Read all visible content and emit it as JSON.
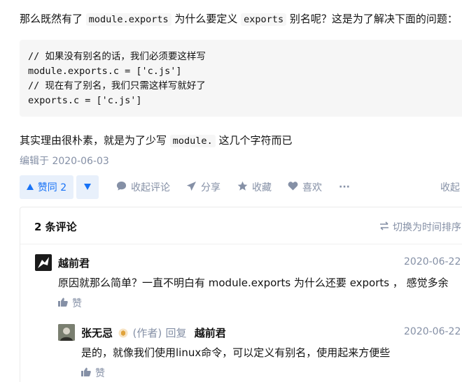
{
  "article": {
    "intro": {
      "part1": "那么既然有了",
      "code1": "module.exports",
      "part2": "为什么要定义",
      "code2": "exports",
      "part3": "别名呢？这是为了解决下面的问题："
    },
    "code_lines": [
      "// 如果没有别名的话，我们必须要这样写",
      "module.exports.c = ['c.js']",
      "// 现在有了别名，我们只需这样写就好了",
      "exports.c = ['c.js']"
    ],
    "outro": {
      "part1": "其实理由很朴素，就是为了少写",
      "code": "module.",
      "part2": "这几个字符而已"
    },
    "edited": "编辑于 2020-06-03"
  },
  "actions": {
    "upvote_label": "赞同 2",
    "collapse_comments": "收起评论",
    "share": "分享",
    "favorite": "收藏",
    "like": "喜欢",
    "more": "···",
    "collapse": "收起"
  },
  "comments": {
    "count_label": "2 条评论",
    "sort_label": "切换为时间排序",
    "items": [
      {
        "author": "越前君",
        "date": "2020-06-22",
        "text": "原因就那么简单？一直不明白有 module.exports 为什么还要 exports ， 感觉多余",
        "like": "赞"
      },
      {
        "author": "张无忌",
        "author_tag": "(作者)",
        "reply_word": "回复",
        "reply_to": "越前君",
        "date": "2020-06-22",
        "text": "是的，就像我们使用linux命令，可以定义有别名，使用起来方便些",
        "like": "赞"
      }
    ]
  },
  "colors": {
    "accent": "#1772f6",
    "vote_bg": "#e8f0fb",
    "muted": "#8590a6",
    "code_bg": "#f6f6f6"
  }
}
